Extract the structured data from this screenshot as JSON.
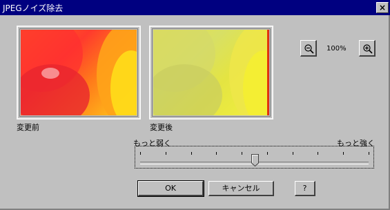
{
  "window": {
    "title": "JPEGノイズ除去",
    "close_label": "×"
  },
  "preview": {
    "before_label": "変更前",
    "after_label": "変更後"
  },
  "zoom": {
    "zoom_out_icon": "zoom-out-icon",
    "level": "100%",
    "zoom_in_icon": "zoom-in-icon"
  },
  "strength_slider": {
    "min_label": "もっと弱く",
    "max_label": "もっと強く",
    "tick_count": 10,
    "value_fraction": 0.5
  },
  "buttons": {
    "ok_label": "OK",
    "cancel_label": "キャンセル",
    "help_label": "?"
  },
  "colors": {
    "title_bar": "#000080",
    "dialog_bg": "#c0c0c0"
  }
}
